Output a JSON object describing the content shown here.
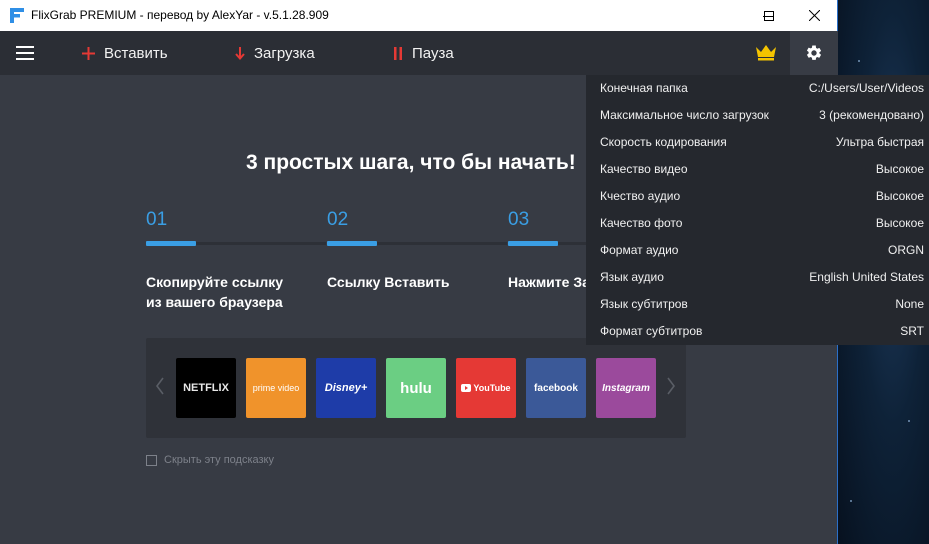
{
  "window": {
    "title": "FlixGrab PREMIUM - перевод by AlexYar - v.5.1.28.909"
  },
  "toolbar": {
    "paste_label": "Вставить",
    "download_label": "Загрузка",
    "pause_label": "Пауза"
  },
  "main": {
    "headline": "3 простых шага, что бы начать!",
    "steps": [
      {
        "number": "01",
        "text_line1": "Скопируйте ссылку",
        "text_line2": "из вашего браузера"
      },
      {
        "number": "02",
        "text_line1": "Ссылку Вставить",
        "text_line2": ""
      },
      {
        "number": "03",
        "text_line1": "Нажмите За",
        "text_line2": ""
      }
    ],
    "services": [
      {
        "name": "NETFLIX",
        "color": "#000000"
      },
      {
        "name": "prime video",
        "color": "#f0932b"
      },
      {
        "name": "Disney+",
        "color": "#1e3ca8"
      },
      {
        "name": "hulu",
        "color": "#6bce83"
      },
      {
        "name": "YouTube",
        "color": "#e53935"
      },
      {
        "name": "facebook",
        "color": "#3b5998"
      },
      {
        "name": "Instagram",
        "color": "#9b4a9c"
      }
    ],
    "hide_tip_label": "Скрыть эту подсказку"
  },
  "settings": {
    "rows": [
      {
        "label": "Конечная папка",
        "value": "C:/Users/User/Videos"
      },
      {
        "label": "Максимальное число загрузок",
        "value": "3 (рекомендовано)"
      },
      {
        "label": "Скорость кодирования",
        "value": "Ультра быстрая"
      },
      {
        "label": "Качество видео",
        "value": "Высокое"
      },
      {
        "label": "Кчество аудио",
        "value": "Высокое"
      },
      {
        "label": "Качество фото",
        "value": "Высокое"
      },
      {
        "label": "Формат аудио",
        "value": "ORGN"
      },
      {
        "label": "Язык аудио",
        "value": "English United States"
      },
      {
        "label": "Язык субтитров",
        "value": "None"
      },
      {
        "label": "Формат субтитров",
        "value": "SRT"
      }
    ]
  },
  "colors": {
    "accent": "#3a9ee4",
    "toolbar_icon": "#e53935",
    "crown": "#f5c400"
  },
  "icons": {
    "menu": "hamburger-icon",
    "paste": "plus-icon",
    "download": "arrow-down-icon",
    "pause": "pause-icon",
    "premium": "crown-icon",
    "settings": "gear-icon"
  }
}
